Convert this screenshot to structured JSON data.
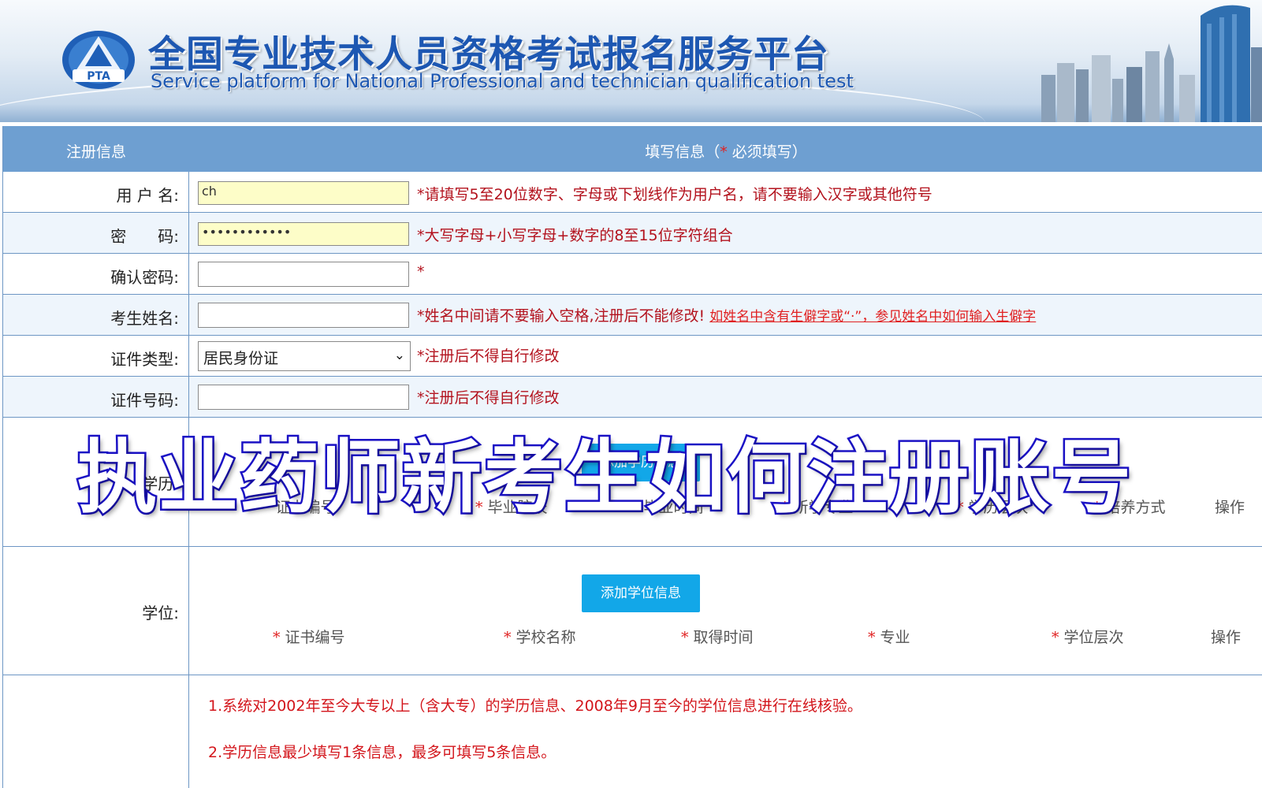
{
  "banner": {
    "logo_text": "PTA",
    "title_cn": "全国专业技术人员资格考试报名服务平台",
    "title_en": "Service platform for National Professional and technician  qualification test"
  },
  "header": {
    "col1": "注册信息",
    "col2_prefix": "填写信息（",
    "col2_star": "*",
    "col2_suffix": " 必须填写）"
  },
  "fields": {
    "username": {
      "label": "用 户 名:",
      "value": "ch",
      "hint": "*请填写5至20位数字、字母或下划线作为用户名，请不要输入汉字或其他符号"
    },
    "password": {
      "label": "密　　码:",
      "value": "••••••••••••",
      "hint": "*大写字母+小写字母+数字的8至15位字符组合"
    },
    "confirm_password": {
      "label": "确认密码:",
      "hint": "*"
    },
    "name": {
      "label": "考生姓名:",
      "hint": "*姓名中间请不要输入空格,注册后不能修改!",
      "link": "如姓名中含有生僻字或“·”，参见姓名中如何输入生僻字"
    },
    "id_type": {
      "label": "证件类型:",
      "value": "居民身份证",
      "hint": "*注册后不得自行修改"
    },
    "id_number": {
      "label": "证件号码:",
      "hint": "*注册后不得自行修改"
    }
  },
  "education": {
    "label": "学历:",
    "add_button": "添加学历信息",
    "columns": [
      "证书编号",
      "毕业院校",
      "毕业时间",
      "所学专业",
      "学历层次",
      "培养方式",
      "操作"
    ]
  },
  "degree": {
    "label": "学位:",
    "add_button": "添加学位信息",
    "columns": [
      "证书编号",
      "学校名称",
      "取得时间",
      "专业",
      "学位层次",
      "操作"
    ]
  },
  "notes": [
    "1.系统对2002年至今大专以上（含大专）的学历信息、2008年9月至今的学位信息进行在线核验。",
    "2.学历信息最少填写1条信息，最多可填写5条信息。"
  ],
  "overlay_caption": "执业药师新考生如何注册账号",
  "colors": {
    "header_bg": "#6e9fd1",
    "row_alt_bg": "#eef5fc",
    "hint_red": "#b3121d",
    "button_blue": "#12a7e8",
    "title_blue": "#1d57b2",
    "overlay_stroke": "#1b12c6"
  }
}
